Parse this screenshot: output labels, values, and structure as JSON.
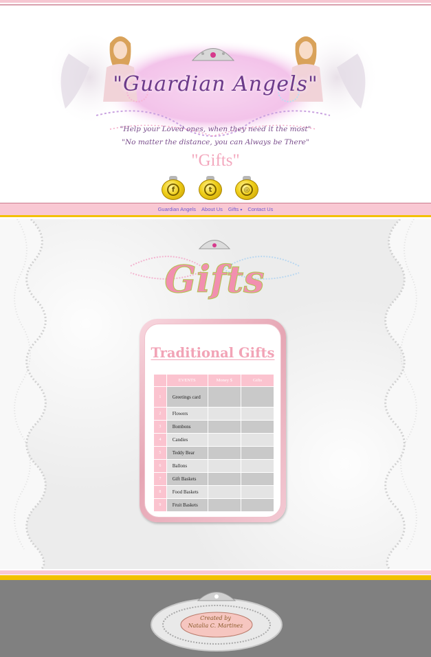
{
  "header": {
    "brand_title": "\"Guardian Angels\"",
    "tagline_line1": "\"Help your Loved ones, when they need it the most\"",
    "tagline_line2": "\"No matter the distance, you can Always be There\"",
    "page_label": "\"Gifts\"",
    "social": [
      {
        "name": "facebook",
        "glyph": "f"
      },
      {
        "name": "twitter",
        "glyph": "t"
      },
      {
        "name": "instagram",
        "glyph": "◎"
      }
    ]
  },
  "nav": {
    "items": [
      "Guardian Angels",
      "About Us",
      "Gifts",
      "Contact Us"
    ],
    "gifts_caret": "▾"
  },
  "main": {
    "logo_text": "Gifts",
    "table": {
      "title": "Traditional Gifts",
      "headers": [
        "",
        "EVENTS",
        "Money $",
        "Gifts"
      ],
      "rows": [
        {
          "num": "1",
          "event": "Greetings card"
        },
        {
          "num": "2",
          "event": "Flowers"
        },
        {
          "num": "3",
          "event": "Bombons"
        },
        {
          "num": "4",
          "event": "Candies"
        },
        {
          "num": "5",
          "event": "Teddy Bear"
        },
        {
          "num": "6",
          "event": "Ballons"
        },
        {
          "num": "7",
          "event": "Gift Baskets"
        },
        {
          "num": "8",
          "event": "Food Baskets"
        },
        {
          "num": "9",
          "event": "Fruit Baskets"
        }
      ]
    }
  },
  "footer": {
    "badge_line1": "Created by",
    "badge_line2": "Natalia C. Martinez"
  },
  "colors": {
    "pink": "#f9c8d3",
    "table_pink": "#fbc3cf",
    "gold": "#f2c100",
    "nav_link": "#6d5bd3",
    "footer_gray": "#808080"
  }
}
